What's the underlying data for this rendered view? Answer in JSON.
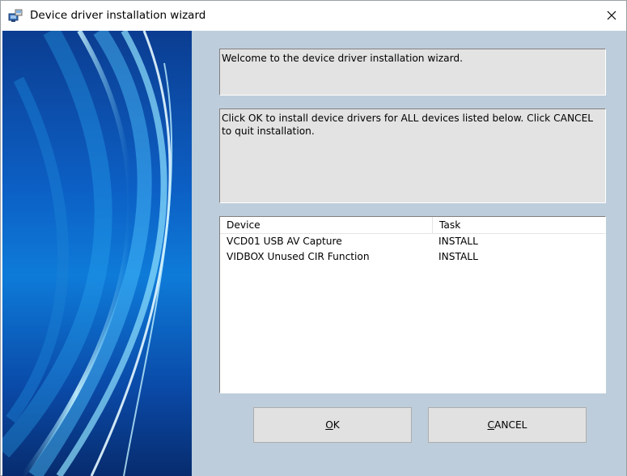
{
  "window": {
    "title": "Device driver installation wizard",
    "icons": {
      "app": "installer-app-icon",
      "close": "close-icon"
    }
  },
  "panels": {
    "welcome_text": "Welcome to the device driver installation wizard.",
    "instructions_text": "Click OK to install device drivers for ALL devices listed below. Click CANCEL to quit installation."
  },
  "device_list": {
    "columns": [
      "Device",
      "Task"
    ],
    "rows": [
      {
        "device": "VCD01 USB AV Capture",
        "task": "INSTALL"
      },
      {
        "device": "VIDBOX Unused CIR Function",
        "task": "INSTALL"
      }
    ]
  },
  "buttons": {
    "ok": {
      "accel": "O",
      "rest": "K"
    },
    "cancel": {
      "accel": "C",
      "rest": "ANCEL"
    }
  },
  "colors": {
    "client_background": "#bdcddb",
    "panel_background": "#e3e3e3",
    "button_background": "#e1e1e1"
  }
}
